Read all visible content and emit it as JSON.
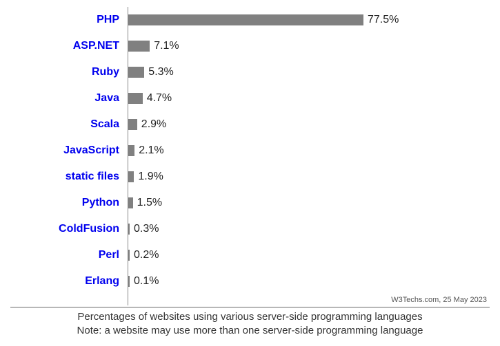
{
  "chart_data": {
    "type": "bar",
    "categories": [
      "PHP",
      "ASP.NET",
      "Ruby",
      "Java",
      "Scala",
      "JavaScript",
      "static files",
      "Python",
      "ColdFusion",
      "Perl",
      "Erlang"
    ],
    "values": [
      77.5,
      7.1,
      5.3,
      4.7,
      2.9,
      2.1,
      1.9,
      1.5,
      0.3,
      0.2,
      0.1
    ],
    "value_labels": [
      "77.5%",
      "7.1%",
      "5.3%",
      "4.7%",
      "2.9%",
      "2.1%",
      "1.9%",
      "1.5%",
      "0.3%",
      "0.2%",
      "0.1%"
    ],
    "title": "Percentages of websites using various server-side programming languages",
    "note": "Note: a website may use more than one server-side programming language",
    "xlabel": "",
    "ylabel": "",
    "xlim": [
      0,
      100
    ]
  },
  "source": "W3Techs.com, 25 May 2023",
  "colors": {
    "bar": "#808080",
    "label_link": "#0000EE"
  }
}
